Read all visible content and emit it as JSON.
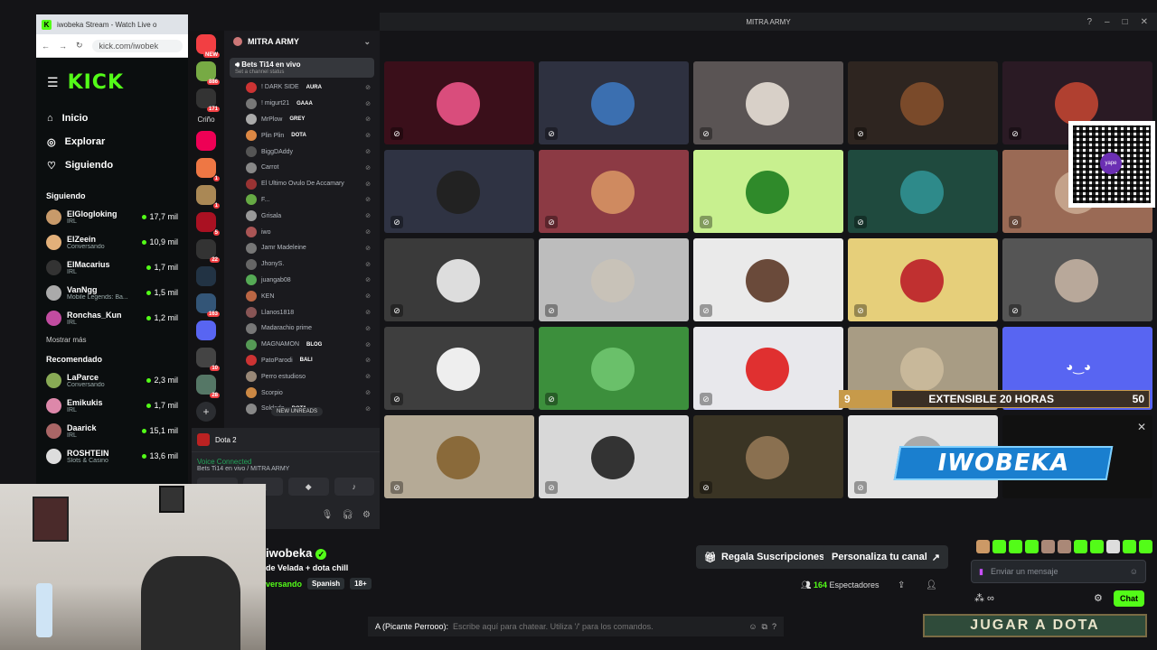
{
  "window": {
    "title": "MITRA ARMY"
  },
  "browser": {
    "tab_title": "iwobeka Stream - Watch Live o",
    "url": "kick.com/iwobek"
  },
  "kick": {
    "logo": "KICK",
    "nav": [
      {
        "label": "Inicio",
        "icon": "home-icon"
      },
      {
        "label": "Explorar",
        "icon": "compass-icon"
      },
      {
        "label": "Siguiendo",
        "icon": "heart-icon"
      }
    ],
    "following_title": "Siguiendo",
    "following": [
      {
        "name": "ElGlogloking",
        "sub": "IRL",
        "count": "17,7 mil",
        "color": "#c89a6a"
      },
      {
        "name": "ElZeein",
        "sub": "Conversando",
        "count": "10,9 mil",
        "color": "#e2b07a"
      },
      {
        "name": "ElMacarius",
        "sub": "IRL",
        "count": "1,7 mil",
        "color": "#333"
      },
      {
        "name": "VanNgg",
        "sub": "Mobile Legends: Ba...",
        "count": "1,5 mil",
        "color": "#aaa"
      },
      {
        "name": "Ronchas_Kun",
        "sub": "IRL",
        "count": "1,2 mil",
        "color": "#c14ca0"
      }
    ],
    "show_more": "Mostrar más",
    "recommended_title": "Recomendado",
    "recommended": [
      {
        "name": "LaParce",
        "sub": "Conversando",
        "count": "2,3 mil",
        "color": "#8a5"
      },
      {
        "name": "Emikukis",
        "sub": "IRL",
        "count": "1,7 mil",
        "color": "#d8a"
      },
      {
        "name": "Daarick",
        "sub": "IRL",
        "count": "15,1 mil",
        "color": "#a66"
      },
      {
        "name": "ROSHTEIN",
        "sub": "Slots & Casino",
        "count": "13,6 mil",
        "color": "#ddd"
      }
    ],
    "streamer": "iwobeka",
    "stream_title": "de Velada + dota chill",
    "category": "versando",
    "language": "Spanish",
    "age": "18+",
    "gift_btn": "Regala Suscripciones",
    "custom_btn": "Personaliza tu canal",
    "viewers": "164",
    "viewers_label": "Espectadores",
    "chat_placeholder": "Enviar un mensaje",
    "chat_btn": "Chat"
  },
  "rail": {
    "label": "Criño",
    "servers": [
      {
        "badge": "NEW",
        "color": "#f23f43"
      },
      {
        "badge": "886",
        "color": "#7a4"
      },
      {
        "badge": "171",
        "color": "#333"
      },
      {
        "badge": "",
        "color": "#e05"
      },
      {
        "badge": "1",
        "color": "#e74"
      },
      {
        "badge": "1",
        "color": "#a85"
      },
      {
        "badge": "5",
        "color": "#a12"
      },
      {
        "badge": "22",
        "color": "#333"
      },
      {
        "badge": "",
        "color": "#234"
      },
      {
        "badge": "163",
        "color": "#357"
      },
      {
        "badge": "",
        "color": "#5865f2"
      },
      {
        "badge": "10",
        "color": "#444"
      },
      {
        "badge": "28",
        "color": "#576"
      }
    ]
  },
  "channels": {
    "server": "MITRA ARMY",
    "voice_channel": "Bets Ti14 en vivo",
    "voice_status": "Set a channel status",
    "users": [
      {
        "name": "! DARK SIDE",
        "tag": "AURA",
        "color": "#c33"
      },
      {
        "name": "! migurt21",
        "tag": "GAAA",
        "color": "#777"
      },
      {
        "name": "MrPlow",
        "tag": "GREY",
        "color": "#aaa"
      },
      {
        "name": "Plin Plin",
        "tag": "DOTA",
        "color": "#d84"
      },
      {
        "name": "BiggDAddy",
        "tag": "",
        "color": "#555"
      },
      {
        "name": "Carrot",
        "tag": "",
        "color": "#888"
      },
      {
        "name": "El Ultimo Ovulo De Accamary",
        "tag": "",
        "color": "#933"
      },
      {
        "name": "F...",
        "tag": "",
        "color": "#6a4"
      },
      {
        "name": "Grisala",
        "tag": "",
        "color": "#999"
      },
      {
        "name": "iwo",
        "tag": "",
        "color": "#a55"
      },
      {
        "name": "Jamr Madeleine",
        "tag": "",
        "color": "#777"
      },
      {
        "name": "JhonyS.",
        "tag": "",
        "color": "#666"
      },
      {
        "name": "juangab08",
        "tag": "",
        "color": "#5a5"
      },
      {
        "name": "KEN",
        "tag": "",
        "color": "#b64"
      },
      {
        "name": "Llanos1818",
        "tag": "",
        "color": "#855"
      },
      {
        "name": "Madarachio prime",
        "tag": "",
        "color": "#777"
      },
      {
        "name": "MAGNAMON",
        "tag": "BLOG",
        "color": "#595"
      },
      {
        "name": "PatoParodi",
        "tag": "BALI",
        "color": "#c33"
      },
      {
        "name": "Perro estudioso",
        "tag": "",
        "color": "#987"
      },
      {
        "name": "Scorpio",
        "tag": "",
        "color": "#c84"
      },
      {
        "name": "Soldado",
        "tag": "DOTA",
        "color": "#888"
      }
    ],
    "new_unreads": "NEW UNREADS"
  },
  "voice_panel": {
    "activity": "Dota 2",
    "status": "Voice Connected",
    "sub": "Bets Ti14 en vivo / MITRA ARMY"
  },
  "tiles": [
    {
      "bg": "#3a0f1a",
      "av": "#d94d7c"
    },
    {
      "bg": "#2e3140",
      "av": "#3b6fb0"
    },
    {
      "bg": "#5a5454",
      "av": "#d8d0c8"
    },
    {
      "bg": "#2e2520",
      "av": "#7a4a2a"
    },
    {
      "bg": "#2a1a24",
      "av": "#b04030"
    },
    {
      "bg": "#2f3343",
      "av": "#222"
    },
    {
      "bg": "#8c3a44",
      "av": "#cf8a60"
    },
    {
      "bg": "#c8f08f",
      "av": "#2f8a2a"
    },
    {
      "bg": "#1f4a3e",
      "av": "#2e8a8a"
    },
    {
      "bg": "#9a6a55",
      "av": "#c4a28a"
    },
    {
      "bg": "#3a3a3a",
      "av": "#ddd"
    },
    {
      "bg": "#bdbdbd",
      "av": "#c8c2b8"
    },
    {
      "bg": "#eaeaea",
      "av": "#6a4a3a"
    },
    {
      "bg": "#e6cf7a",
      "av": "#c03030"
    },
    {
      "bg": "#555",
      "av": "#b8a89a"
    },
    {
      "bg": "#3e3e3e",
      "av": "#eee"
    },
    {
      "bg": "#3c8f3c",
      "av": "#6ac06a"
    },
    {
      "bg": "#e8e8ec",
      "av": "#e03030"
    },
    {
      "bg": "#a89c84",
      "av": "#c8b89a"
    },
    {
      "bg": "#5865f2",
      "av": "#5865f2"
    },
    {
      "bg": "#b5aa96",
      "av": "#8a6a3a"
    },
    {
      "bg": "#d8d8d8",
      "av": "#333"
    },
    {
      "bg": "#3a3424",
      "av": "#8a7050"
    },
    {
      "bg": "#e4e4e4",
      "av": "#aaa"
    },
    {
      "bg": "#111",
      "av": "#111"
    }
  ],
  "overlay": {
    "ext_left": "9",
    "ext_text": "EXTENSIBLE 20 HORAS",
    "ext_right": "50",
    "ext_progress": 0.17,
    "banner": "IWOBEKA",
    "jugar": "JUGAR A DOTA"
  },
  "discord_chat": {
    "user": "A (Picante Perrooo):",
    "placeholder": "Escribe aquí para chatear. Utiliza '/' para los comandos."
  }
}
